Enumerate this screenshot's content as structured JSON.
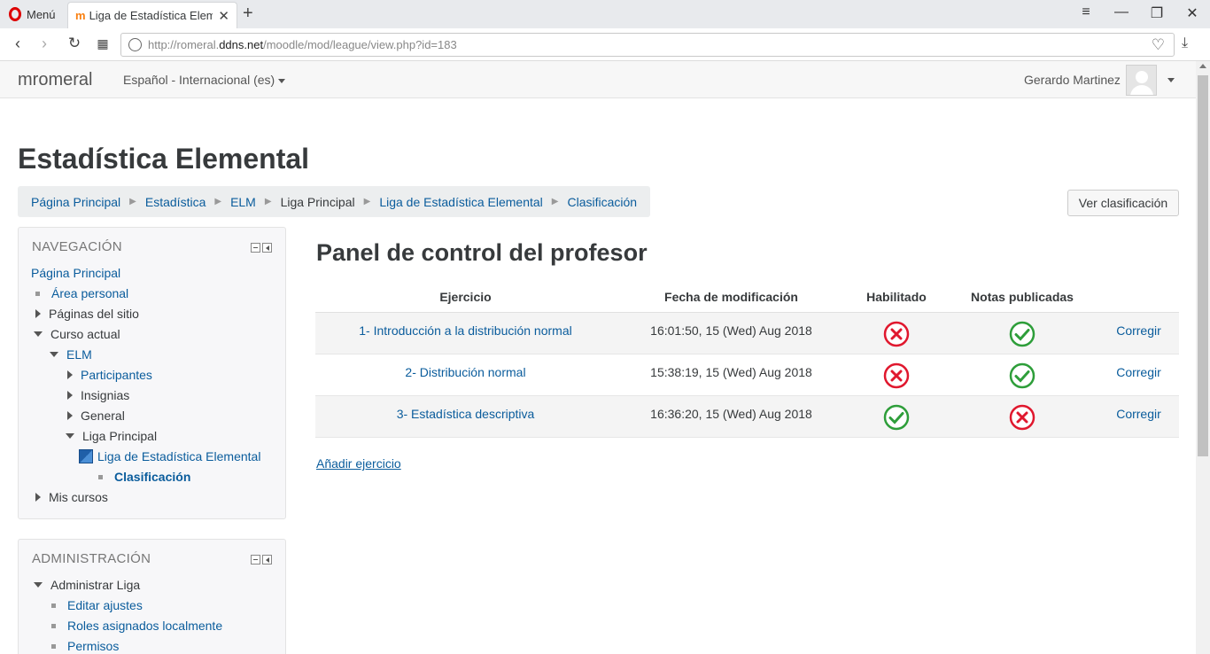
{
  "browser": {
    "menu_label": "Menú",
    "tab_title": "Liga de Estadística Elemental",
    "tab_favicon": "m",
    "url_prefix": "http://romeral.",
    "url_host": "ddns.net",
    "url_path": "/moodle/mod/league/view.php?id=183"
  },
  "navbar": {
    "brand": "mromeral",
    "language": "Español - Internacional (es)",
    "user_name": "Gerardo Martinez"
  },
  "page": {
    "title": "Estadística Elemental",
    "ver_button": "Ver clasificación"
  },
  "breadcrumb": [
    {
      "label": "Página Principal",
      "link": true
    },
    {
      "label": "Estadística",
      "link": true
    },
    {
      "label": "ELM",
      "link": true
    },
    {
      "label": "Liga Principal",
      "link": false
    },
    {
      "label": "Liga de Estadística Elemental",
      "link": true
    },
    {
      "label": "Clasificación",
      "link": true
    }
  ],
  "nav_block": {
    "title": "NAVEGACIÓN",
    "items": {
      "home": "Página Principal",
      "area": "Área personal",
      "site_pages": "Páginas del sitio",
      "current_course": "Curso actual",
      "elm": "ELM",
      "participants": "Participantes",
      "badges": "Insignias",
      "general": "General",
      "main_league": "Liga Principal",
      "league": "Liga de Estadística Elemental",
      "classification": "Clasificación",
      "my_courses": "Mis cursos"
    }
  },
  "admin_block": {
    "title": "ADMINISTRACIÓN",
    "items": {
      "manage": "Administrar Liga",
      "edit": "Editar ajustes",
      "roles": "Roles asignados localmente",
      "permissions": "Permisos"
    }
  },
  "panel": {
    "title": "Panel de control del profesor",
    "headers": {
      "exercise": "Ejercicio",
      "modified": "Fecha de modificación",
      "enabled": "Habilitado",
      "published": "Notas publicadas"
    },
    "rows": [
      {
        "exercise": "1- Introducción a la distribución normal",
        "modified": "16:01:50, 15 (Wed) Aug 2018",
        "enabled": false,
        "published": true,
        "action": "Corregir"
      },
      {
        "exercise": "2- Distribución normal",
        "modified": "15:38:19, 15 (Wed) Aug 2018",
        "enabled": false,
        "published": true,
        "action": "Corregir"
      },
      {
        "exercise": "3- Estadística descriptiva",
        "modified": "16:36:20, 15 (Wed) Aug 2018",
        "enabled": true,
        "published": false,
        "action": "Corregir"
      }
    ],
    "add_link": "Añadir ejercicio"
  },
  "colors": {
    "link": "#0a5c9c",
    "ok": "#2e9e3a",
    "error": "#e0182e"
  }
}
